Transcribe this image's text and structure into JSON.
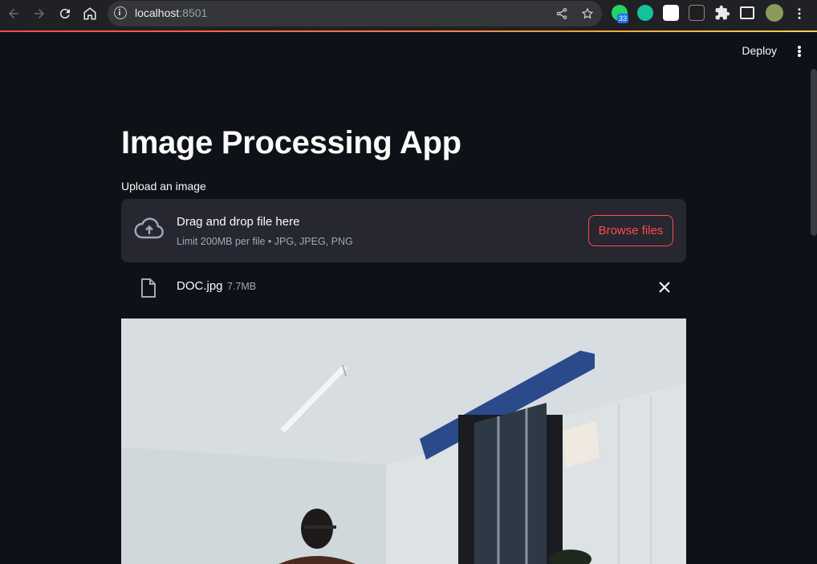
{
  "browser": {
    "url_host": "localhost",
    "url_port": ":8501",
    "whatsapp_badge": "33"
  },
  "header": {
    "deploy_label": "Deploy"
  },
  "main": {
    "title": "Image Processing App",
    "uploader": {
      "label": "Upload an image",
      "drag_text": "Drag and drop file here",
      "limit_text": "Limit 200MB per file • JPG, JPEG, PNG",
      "browse_label": "Browse files"
    },
    "file": {
      "name": "DOC.jpg",
      "size": "7.7MB"
    }
  },
  "colors": {
    "accent": "#ff4b4b",
    "background": "#0e1117",
    "dropzone": "#262730"
  },
  "icons": {
    "upload": "cloud-upload-icon",
    "file": "file-icon",
    "remove": "close-icon"
  }
}
